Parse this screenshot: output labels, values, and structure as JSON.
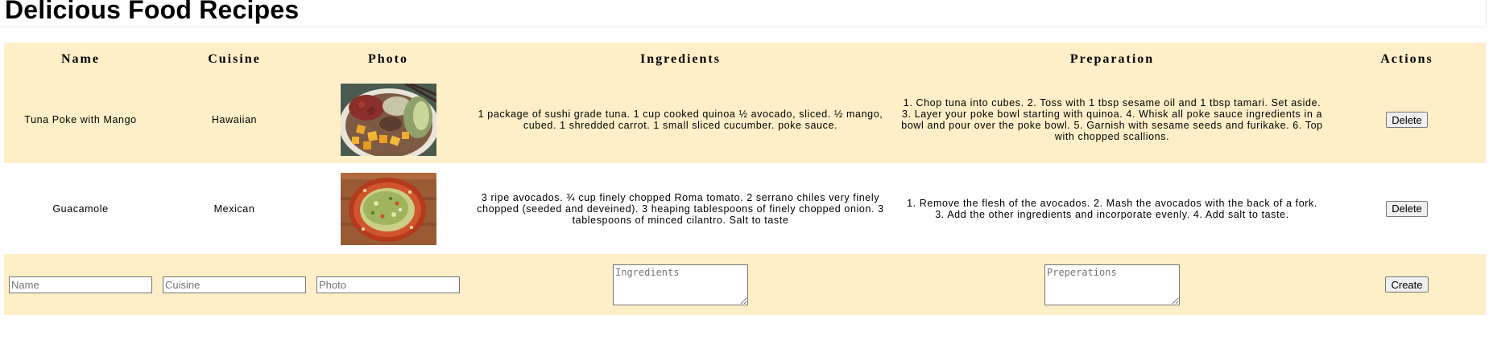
{
  "page": {
    "title": "Delicious Food Recipes"
  },
  "table": {
    "headers": {
      "name": "Name",
      "cuisine": "Cuisine",
      "photo": "Photo",
      "ingredients": "Ingredients",
      "preparation": "Preparation",
      "actions": "Actions"
    },
    "rows": [
      {
        "name": "Tuna Poke with Mango",
        "cuisine": "Hawaiian",
        "photo_alt": "poke bowl photo",
        "ingredients": "1 package of sushi grade tuna. 1 cup cooked quinoa ½ avocado, sliced. ½ mango, cubed. 1 shredded carrot. 1 small sliced cucumber. poke sauce.",
        "preparation": "1. Chop tuna into cubes. 2. Toss with 1 tbsp sesame oil and 1 tbsp tamari. Set aside. 3. Layer your poke bowl starting with quinoa. 4. Whisk all poke sauce ingredients in a bowl and pour over the poke bowl. 5. Garnish with sesame seeds and furikake. 6. Top with chopped scallions.",
        "delete_label": "Delete"
      },
      {
        "name": "Guacamole",
        "cuisine": "Mexican",
        "photo_alt": "guacamole photo",
        "ingredients": "3 ripe avocados. ¾ cup finely chopped Roma tomato. 2 serrano chiles very finely chopped (seeded and deveined). 3 heaping tablespoons of finely chopped onion. 3 tablespoons of minced cilantro. Salt to taste",
        "preparation": "1. Remove the flesh of the avocados. 2. Mash the avocados with the back of a fork. 3. Add the other ingredients and incorporate evenly. 4. Add salt to taste.",
        "delete_label": "Delete"
      }
    ]
  },
  "form": {
    "name_placeholder": "Name",
    "cuisine_placeholder": "Cuisine",
    "photo_placeholder": "Photo",
    "ingredients_placeholder": "Ingredients",
    "preparation_placeholder": "Preperations",
    "create_label": "Create"
  },
  "colors": {
    "row_highlight": "#ffefc8",
    "row_plain": "#ffffff"
  }
}
